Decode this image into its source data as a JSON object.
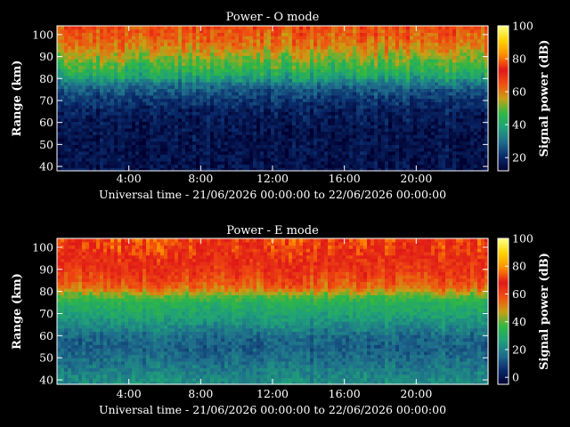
{
  "chart_data": [
    {
      "type": "heatmap",
      "title": "Power - O mode",
      "xlabel": "Universal time - 21/06/2026 00:00:00 to 22/06/2026 00:00:00",
      "ylabel": "Range (km)",
      "xlim_hours": [
        0,
        24
      ],
      "xticks_hours": [
        4,
        8,
        12,
        16,
        20
      ],
      "xtick_labels": [
        "4:00",
        "8:00",
        "12:00",
        "16:00",
        "20:00"
      ],
      "ylim": [
        38,
        104
      ],
      "yticks": [
        40,
        50,
        60,
        70,
        80,
        90,
        100
      ],
      "colorbar": {
        "label": "Signal power (dB)",
        "range": [
          12,
          100
        ],
        "ticks": [
          20,
          40,
          60,
          80,
          100
        ]
      },
      "colormap": [
        "#000030",
        "#0a2a6a",
        "#1f6c8c",
        "#1fa07a",
        "#2fb844",
        "#c8a014",
        "#f05010",
        "#e01818",
        "#ff8c00",
        "#ffd200",
        "#ffff80"
      ],
      "profile_km": [
        [
          40,
          16
        ],
        [
          50,
          16
        ],
        [
          60,
          17
        ],
        [
          66,
          19
        ],
        [
          70,
          22
        ],
        [
          75,
          27
        ],
        [
          78,
          32
        ],
        [
          81,
          40
        ],
        [
          84,
          45
        ],
        [
          88,
          50
        ],
        [
          92,
          56
        ],
        [
          96,
          61
        ],
        [
          100,
          64
        ],
        [
          104,
          66
        ]
      ],
      "grid": false
    },
    {
      "type": "heatmap",
      "title": "Power - E mode",
      "xlabel": "Universal time - 21/06/2026 00:00:00 to 22/06/2026 00:00:00",
      "ylabel": "Range (km)",
      "xlim_hours": [
        0,
        24
      ],
      "xticks_hours": [
        4,
        8,
        12,
        16,
        20
      ],
      "xtick_labels": [
        "4:00",
        "8:00",
        "12:00",
        "16:00",
        "20:00"
      ],
      "ylim": [
        38,
        104
      ],
      "yticks": [
        40,
        50,
        60,
        70,
        80,
        90,
        100
      ],
      "colorbar": {
        "label": "Signal power (dB)",
        "range": [
          -5,
          100
        ],
        "ticks": [
          0,
          20,
          40,
          60,
          80,
          100
        ]
      },
      "colormap": [
        "#000030",
        "#0a2a6a",
        "#1f6c8c",
        "#1fa07a",
        "#2fb844",
        "#c8a014",
        "#f05010",
        "#e01818",
        "#ff8c00",
        "#ffd200",
        "#ffff80"
      ],
      "profile_km": [
        [
          40,
          22
        ],
        [
          50,
          16
        ],
        [
          55,
          14
        ],
        [
          60,
          16
        ],
        [
          65,
          22
        ],
        [
          70,
          28
        ],
        [
          75,
          33
        ],
        [
          78,
          40
        ],
        [
          82,
          55
        ],
        [
          86,
          60
        ],
        [
          92,
          65
        ],
        [
          98,
          70
        ],
        [
          104,
          72
        ]
      ],
      "grid": false
    }
  ]
}
